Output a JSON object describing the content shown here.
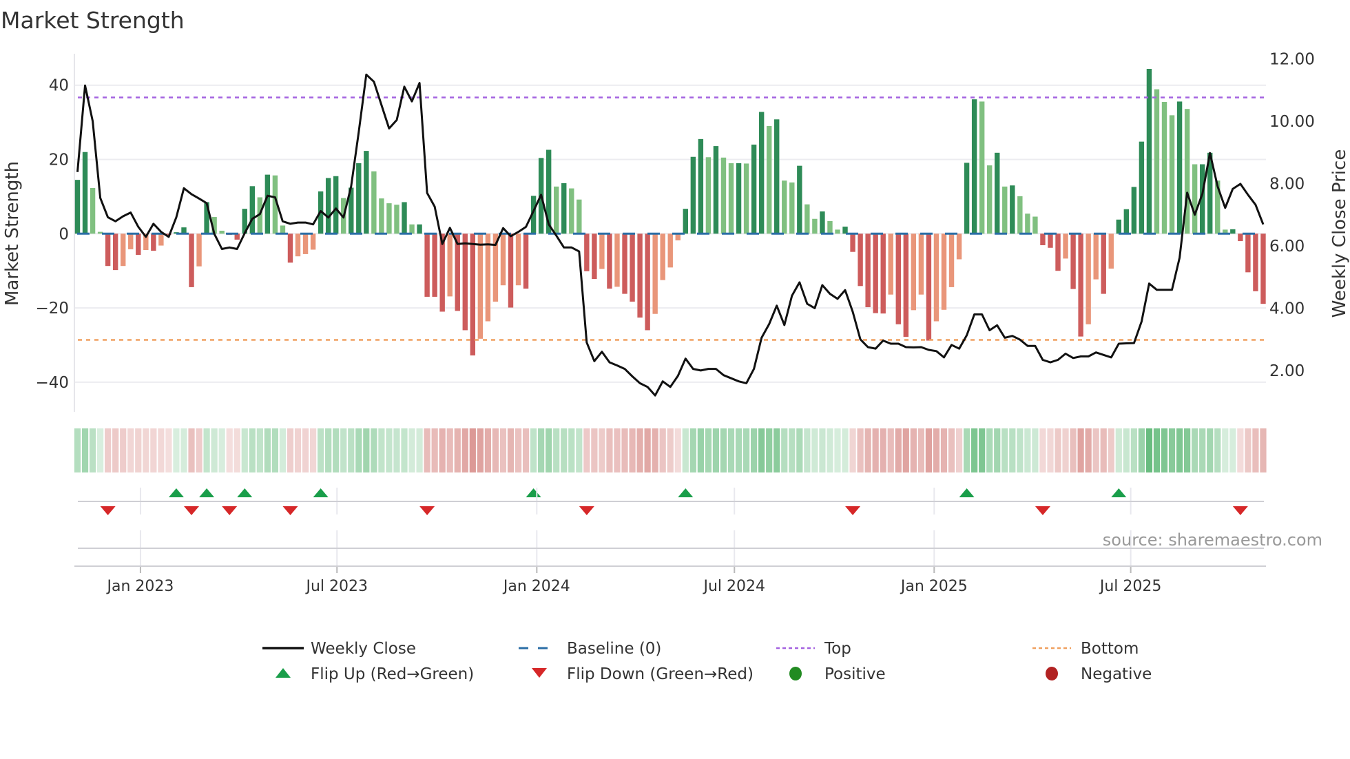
{
  "chart_data": {
    "type": "bar",
    "title": "Market Strength",
    "ylabel": "Market Strength",
    "y2label": "Weekly Close Price",
    "ylim": [
      -50,
      48
    ],
    "y2lim": [
      0.8,
      12.2
    ],
    "yticks": [
      "40",
      "20",
      "0",
      "−20",
      "−40"
    ],
    "ytick_values": [
      40,
      20,
      0,
      -20,
      -40
    ],
    "y2ticks": [
      "12.00",
      "10.00",
      "8.00",
      "6.00",
      "4.00",
      "2.00"
    ],
    "y2tick_values": [
      12,
      10,
      8,
      6,
      4,
      2
    ],
    "first_week": "2022-11-04",
    "interval_days": 7,
    "xticks": [
      {
        "label": "Jan 2023",
        "date": "2023-01-01"
      },
      {
        "label": "Jul 2023",
        "date": "2023-07-01"
      },
      {
        "label": "Jan 2024",
        "date": "2024-01-01"
      },
      {
        "label": "Jul 2024",
        "date": "2024-07-01"
      },
      {
        "label": "Jan 2025",
        "date": "2025-01-01"
      },
      {
        "label": "Jul 2025",
        "date": "2025-07-01"
      }
    ],
    "top_level": 36.7,
    "bottom_level": -28.6,
    "strength": [
      14.5,
      22,
      12.3,
      0.5,
      -8.7,
      -9.8,
      -8.7,
      -4.2,
      -5.7,
      -4.4,
      -4.6,
      -3.2,
      -0.3,
      0.4,
      1.7,
      -14.4,
      -8.8,
      8.5,
      4.5,
      0.8,
      -0.3,
      -1.6,
      6.7,
      12.8,
      9.8,
      15.9,
      15.7,
      2.2,
      -7.8,
      -6.1,
      -5.5,
      -4.3,
      11.4,
      15,
      15.5,
      9.6,
      12.4,
      19,
      22.3,
      16.8,
      9.5,
      8.2,
      7.8,
      8.5,
      2.5,
      2.5,
      -17,
      -17,
      -21,
      -16.9,
      -20.8,
      -26,
      -32.8,
      -28.3,
      -23.6,
      -18.3,
      -13.9,
      -19.9,
      -13.9,
      -14.8,
      10.2,
      20.4,
      22.6,
      12.7,
      13.6,
      12.2,
      9.2,
      -10.1,
      -12.2,
      -9.5,
      -14.8,
      -14.3,
      -16.2,
      -18.3,
      -22.6,
      -26,
      -21.6,
      -12.5,
      -9.1,
      -1.8,
      6.7,
      20.7,
      25.5,
      20.6,
      23.6,
      20.5,
      19,
      19,
      18.9,
      24,
      32.8,
      29,
      30.8,
      14.3,
      13.8,
      18.3,
      7.9,
      4,
      6,
      3.4,
      1.1,
      1.9,
      -4.9,
      -14.1,
      -19.8,
      -21.4,
      -21.5,
      -16.4,
      -24.4,
      -27.8,
      -20.6,
      -16.4,
      -28.8,
      -23.6,
      -20.5,
      -14.4,
      -6.9,
      19.1,
      36.2,
      35.6,
      18.4,
      21.8,
      12.7,
      13,
      10.1,
      5.4,
      4.6,
      -3.1,
      -3.8,
      -10,
      -6.7,
      -14.9,
      -27.7,
      -24.4,
      -12.3,
      -16.2,
      -9.4,
      3.8,
      6.6,
      12.6,
      24.8,
      44.4,
      38.9,
      35.5,
      31.9,
      35.6,
      33.6,
      18.7,
      18.7,
      21.8,
      14.3,
      1.1,
      1.2,
      -2,
      -10.4,
      -15.5,
      -18.9
    ],
    "tone": "ddllddlldldlddddldllddddldlldllldddldddlllldlddddldddlllldlddddldllddldlddddlllldddldlldlddldlldlldllddddddldd lldllllddlldldlllddd lddlldlddd ddllldlldd llddddd",
    "weekly_close": [
      8.37,
      11.15,
      10.0,
      7.54,
      6.92,
      6.79,
      6.95,
      7.07,
      6.61,
      6.29,
      6.71,
      6.45,
      6.29,
      6.92,
      7.85,
      7.66,
      7.52,
      7.37,
      6.39,
      5.9,
      5.95,
      5.9,
      6.41,
      6.87,
      7.02,
      7.61,
      7.56,
      6.79,
      6.71,
      6.75,
      6.75,
      6.69,
      7.12,
      6.91,
      7.2,
      6.91,
      7.91,
      9.65,
      11.5,
      11.27,
      10.52,
      9.77,
      10.04,
      11.11,
      10.64,
      11.23,
      7.7,
      7.26,
      6.06,
      6.58,
      6.06,
      6.08,
      6.06,
      6.04,
      6.05,
      6.03,
      6.57,
      6.31,
      6.45,
      6.61,
      7.12,
      7.64,
      6.69,
      6.33,
      5.95,
      5.95,
      5.82,
      2.9,
      2.3,
      2.6,
      2.26,
      2.16,
      2.05,
      1.81,
      1.59,
      1.47,
      1.2,
      1.65,
      1.47,
      1.83,
      2.38,
      2.05,
      2.0,
      2.05,
      2.05,
      1.85,
      1.75,
      1.65,
      1.59,
      2.05,
      3.05,
      3.49,
      4.08,
      3.46,
      4.4,
      4.83,
      4.14,
      4.0,
      4.74,
      4.46,
      4.3,
      4.58,
      3.88,
      3.0,
      2.75,
      2.7,
      2.96,
      2.86,
      2.86,
      2.75,
      2.74,
      2.75,
      2.66,
      2.62,
      2.42,
      2.82,
      2.7,
      3.13,
      3.8,
      3.8,
      3.29,
      3.45,
      3.05,
      3.11,
      2.99,
      2.79,
      2.79,
      2.34,
      2.26,
      2.34,
      2.54,
      2.4,
      2.45,
      2.45,
      2.58,
      2.5,
      2.42,
      2.86,
      2.87,
      2.88,
      3.57,
      4.79,
      4.59,
      4.59,
      4.59,
      5.62,
      7.71,
      7.0,
      7.67,
      8.98,
      7.91,
      7.22,
      7.83,
      7.99,
      7.64,
      7.32,
      6.69
    ],
    "flip_up_weeks": [
      14,
      18,
      23,
      33,
      61,
      81,
      118,
      138
    ],
    "flip_down_weeks": [
      5,
      16,
      21,
      29,
      47,
      68,
      103,
      128,
      154
    ],
    "legend": {
      "placement": "bottom",
      "items": [
        {
          "label": "Weekly Close",
          "kind": "line"
        },
        {
          "label": "Baseline (0)",
          "kind": "dash"
        },
        {
          "label": "Top",
          "kind": "dot-top"
        },
        {
          "label": "Bottom",
          "kind": "dot-bottom"
        },
        {
          "label": "Flip Up (Red→Green)",
          "kind": "tri-up"
        },
        {
          "label": "Flip Down (Green→Red)",
          "kind": "tri-down"
        },
        {
          "label": "Positive",
          "kind": "circle-pos"
        },
        {
          "label": "Negative",
          "kind": "circle-neg"
        }
      ]
    },
    "source": "source: sharemaestro.com",
    "colors": {
      "strong_green": "#2e8b57",
      "weak_green": "#80c080",
      "strong_red": "#cd5c5c",
      "weak_red": "#e9967a",
      "price": "#111111",
      "baseline": "#2b6ea6",
      "top": "#a463e0",
      "bottom": "#f0a060",
      "flip_up": "#1a9e4a",
      "flip_down": "#d62728",
      "positive": "#228b22",
      "negative": "#b22222"
    }
  }
}
